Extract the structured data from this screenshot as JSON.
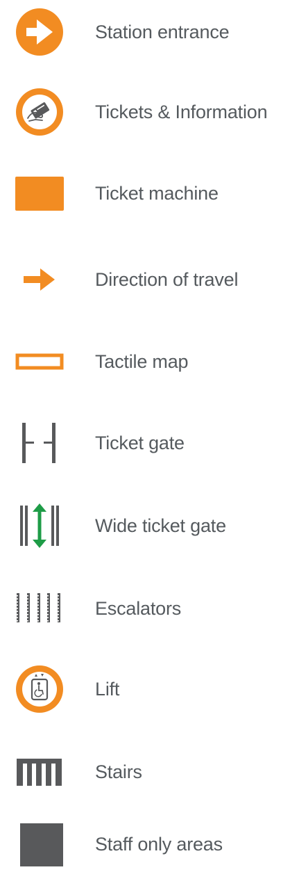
{
  "colors": {
    "orange": "#f28c22",
    "grey": "#58595b",
    "green": "#1e9c47",
    "text": "#555a5e"
  },
  "legend": {
    "items": [
      {
        "icon": "station-entrance-icon",
        "label": "Station entrance"
      },
      {
        "icon": "tickets-information-icon",
        "label": "Tickets & Information"
      },
      {
        "icon": "ticket-machine-icon",
        "label": "Ticket machine"
      },
      {
        "icon": "direction-of-travel-icon",
        "label": "Direction of travel"
      },
      {
        "icon": "tactile-map-icon",
        "label": "Tactile map"
      },
      {
        "icon": "ticket-gate-icon",
        "label": "Ticket gate"
      },
      {
        "icon": "wide-ticket-gate-icon",
        "label": "Wide ticket gate"
      },
      {
        "icon": "escalators-icon",
        "label": "Escalators"
      },
      {
        "icon": "lift-icon",
        "label": "Lift"
      },
      {
        "icon": "stairs-icon",
        "label": "Stairs"
      },
      {
        "icon": "staff-only-areas-icon",
        "label": "Staff only areas"
      }
    ]
  }
}
